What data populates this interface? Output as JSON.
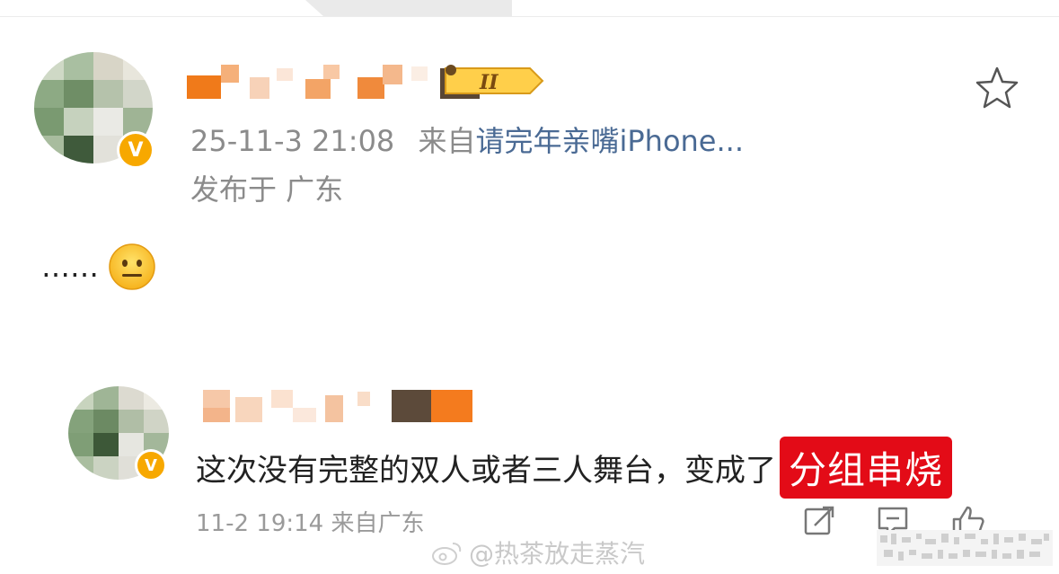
{
  "post": {
    "timestamp": "25-11-3 21:08",
    "source_prefix": "来自",
    "source_name": "请完年亲嘴iPhone...",
    "location": "发布于 广东",
    "content": "……",
    "level_badge": "II"
  },
  "reply": {
    "text": "这次没有完整的双人或者三人舞台，变成了",
    "highlight": "分组串烧",
    "meta": "11-2 19:14 来自广东"
  },
  "watermark": {
    "text": "@热茶放走蒸汽"
  },
  "colors": {
    "highlight_bg": "#e30b17",
    "source_link": "#4a6a94",
    "meta_gray": "#8b8b8b",
    "verified_badge": "#f7a800"
  }
}
